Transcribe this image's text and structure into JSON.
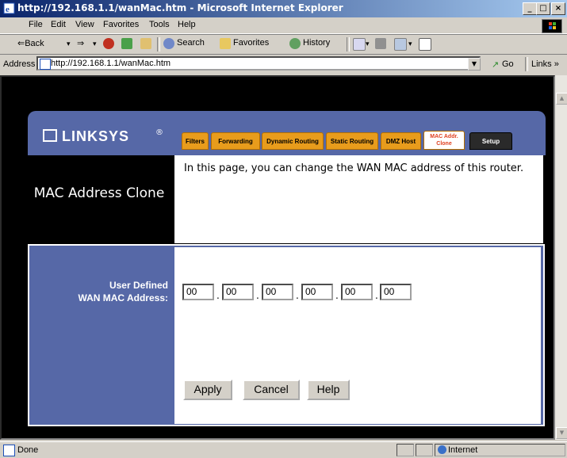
{
  "window": {
    "title": "http://192.168.1.1/wanMac.htm - Microsoft Internet Explorer",
    "controls": [
      "_",
      "□",
      "×"
    ]
  },
  "menu": [
    "File",
    "Edit",
    "View",
    "Favorites",
    "Tools",
    "Help"
  ],
  "toolbar": {
    "back": "⇐Back",
    "forward": "⇒",
    "search": "Search",
    "favorites": "Favorites",
    "history": "History"
  },
  "address": {
    "label": "Address",
    "url": "http://192.168.1.1/wanMac.htm",
    "go": "Go",
    "links": "Links »"
  },
  "page": {
    "logo": "LINKSYS",
    "logo_mark": "®",
    "tabs": [
      "Filters",
      "Forwarding",
      "Dynamic Routing",
      "Static Routing",
      "DMZ Host",
      "MAC Addr. Clone",
      "Setup"
    ],
    "title": "MAC Address Clone",
    "description": "In this page, you can change the WAN MAC address of this router.",
    "form_label_line1": "User Defined",
    "form_label_line2": "WAN MAC Address:",
    "mac_octets": [
      "00",
      "00",
      "00",
      "00",
      "00",
      "00"
    ],
    "buttons": {
      "apply": "Apply",
      "cancel": "Cancel",
      "help": "Help"
    }
  },
  "status": {
    "text": "Done",
    "zone": "Internet"
  },
  "colors": {
    "title_gradient_start": "#0a246a",
    "linksys_blue": "#5668a7",
    "tab_orange": "#e89c1c",
    "active_tab_text": "#e04020"
  }
}
